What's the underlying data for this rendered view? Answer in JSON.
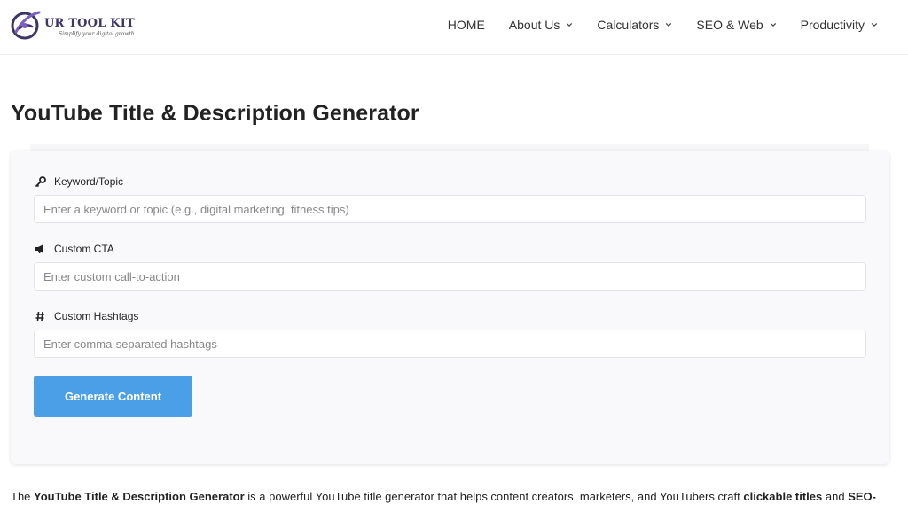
{
  "brand": {
    "name": "UR TOOL KIT",
    "tagline": "Simplify your digital growth",
    "logo_icon": "logo-swirl-icon",
    "colors": {
      "primary": "#3c3566",
      "accent": "#7a5fc0"
    }
  },
  "nav": {
    "items": [
      {
        "label": "HOME",
        "has_dropdown": false
      },
      {
        "label": "About Us",
        "has_dropdown": true
      },
      {
        "label": "Calculators",
        "has_dropdown": true
      },
      {
        "label": "SEO & Web",
        "has_dropdown": true
      },
      {
        "label": "Productivity",
        "has_dropdown": true
      }
    ]
  },
  "page": {
    "title": "YouTube Title & Description Generator"
  },
  "form": {
    "keyword": {
      "icon": "key-icon",
      "label": "Keyword/Topic",
      "placeholder": "Enter a keyword or topic (e.g., digital marketing, fitness tips)",
      "value": ""
    },
    "cta": {
      "icon": "megaphone-icon",
      "label": "Custom CTA",
      "placeholder": "Enter custom call-to-action",
      "value": ""
    },
    "hashtags": {
      "icon": "hashtag-icon",
      "label": "Custom Hashtags",
      "placeholder": "Enter comma-separated hashtags",
      "value": ""
    },
    "submit_label": "Generate Content"
  },
  "description": {
    "prefix": "The ",
    "tool_name": "YouTube Title & Description Generator",
    "middle": " is a powerful YouTube title generator that helps content creators, marketers, and YouTubers craft ",
    "highlight": "clickable titles",
    "joiner": " and ",
    "suffix": "SEO-"
  },
  "colors": {
    "button": "#4a9fe6",
    "card_bg": "#f9f9fb",
    "text": "#222222"
  }
}
